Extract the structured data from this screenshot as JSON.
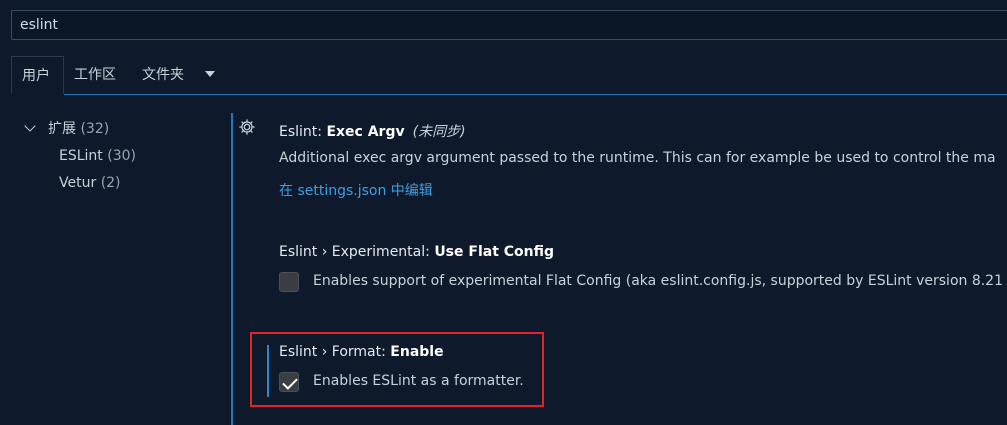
{
  "search": {
    "value": "eslint"
  },
  "tabs": [
    {
      "label": "用户",
      "active": true
    },
    {
      "label": "工作区",
      "active": false
    },
    {
      "label": "文件夹",
      "active": false
    }
  ],
  "sidebar": {
    "root": {
      "label": "扩展",
      "count": "(32)"
    },
    "children": [
      {
        "label": "ESLint",
        "count": "(30)"
      },
      {
        "label": "Vetur",
        "count": "(2)"
      }
    ]
  },
  "settings": {
    "exec_argv": {
      "prefix": "Eslint: ",
      "name": "Exec Argv",
      "note": "(未同步)",
      "description": "Additional exec argv argument passed to the runtime. This can for example be used to control the ma",
      "link": "在 settings.json 中编辑"
    },
    "flat_config": {
      "prefix": "Eslint › Experimental: ",
      "name": "Use Flat Config",
      "description": "Enables support of experimental Flat Config (aka eslint.config.js, supported by ESLint version 8.21",
      "checked": false
    },
    "format_enable": {
      "prefix": "Eslint › Format: ",
      "name": "Enable",
      "description": "Enables ESLint as a formatter.",
      "checked": true
    }
  },
  "colors": {
    "background": "#0e1a2b",
    "accent": "#1e79c1",
    "link": "#3c9ee5",
    "highlight": "#e5212a"
  }
}
